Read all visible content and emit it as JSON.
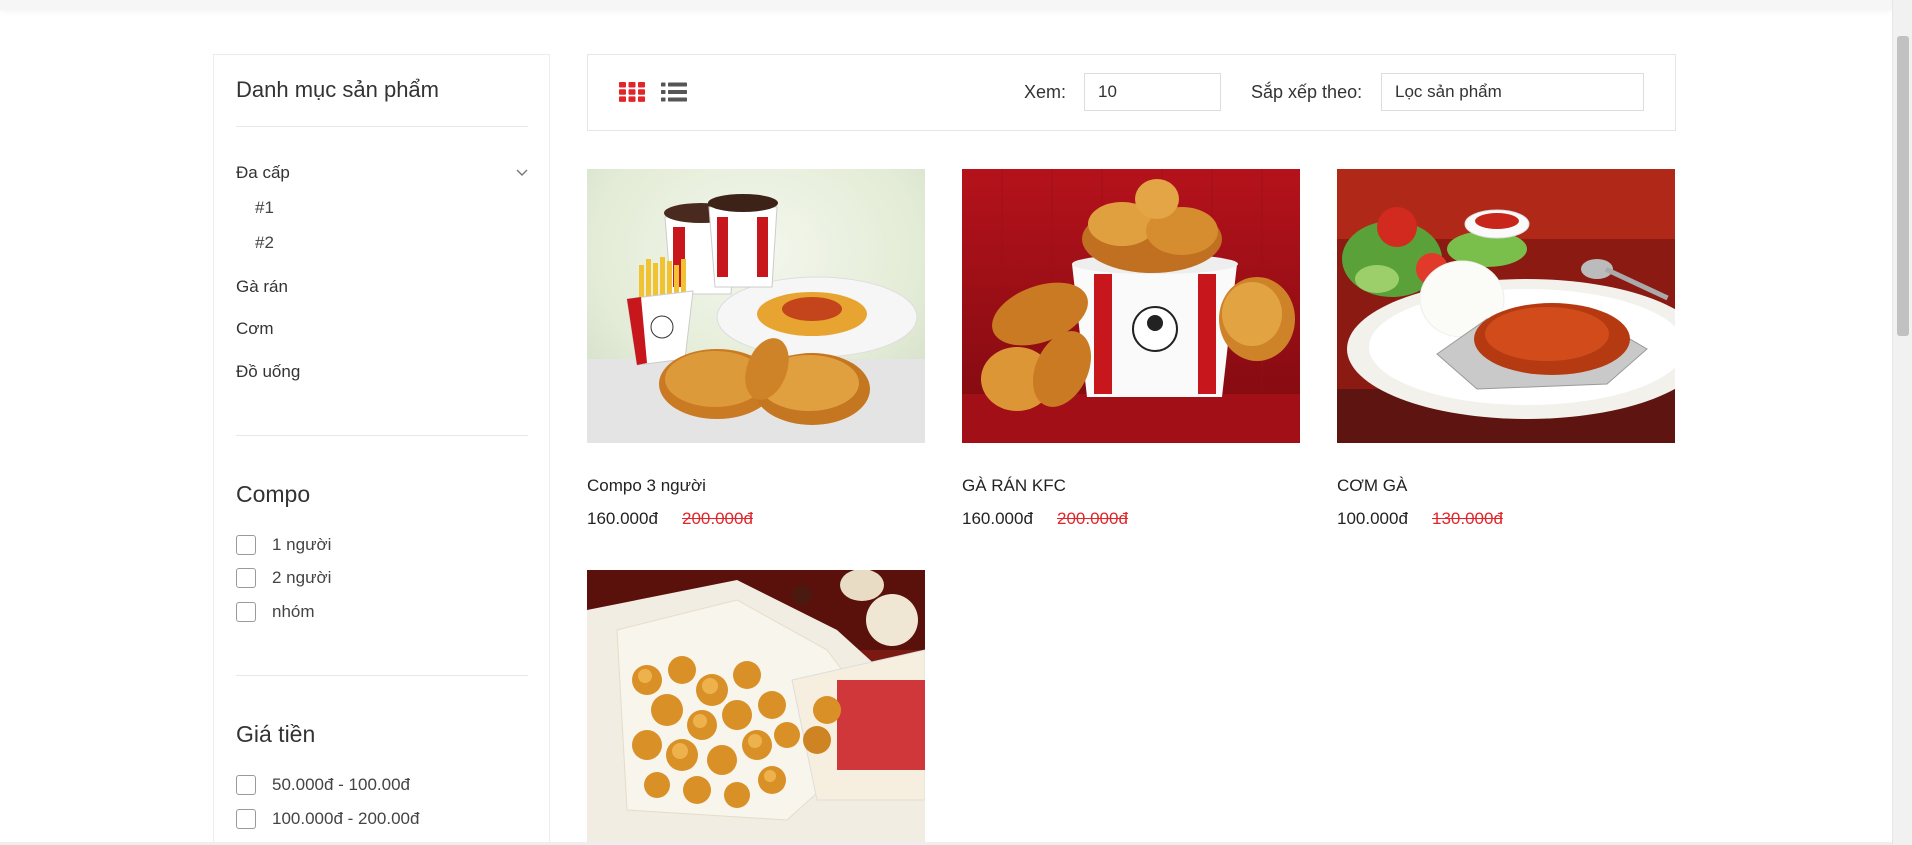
{
  "sidebar": {
    "title": "Danh mục sản phẩm",
    "categories": [
      {
        "label": "Đa cấp",
        "children": [
          "#1",
          "#2"
        ]
      },
      {
        "label": "Gà rán"
      },
      {
        "label": "Cơm"
      },
      {
        "label": "Đồ uống"
      }
    ],
    "compo": {
      "heading": "Compo",
      "options": [
        "1 người",
        "2 người",
        "nhóm"
      ]
    },
    "price": {
      "heading": "Giá tiền",
      "options": [
        "50.000đ - 100.00đ",
        "100.000đ - 200.00đ"
      ]
    }
  },
  "toolbar": {
    "view_label": "Xem:",
    "view_value": "10",
    "sort_label": "Sắp xếp theo:",
    "sort_value": "Lọc sản phẩm",
    "grid_icon": "grid-view-icon",
    "list_icon": "list-view-icon",
    "accent_color": "#e0262b"
  },
  "products": [
    {
      "name": "Compo 3 người",
      "price": "160.000đ",
      "old_price": "200.000đ"
    },
    {
      "name": "GÀ RÁN KFC",
      "price": "160.000đ",
      "old_price": "200.000đ"
    },
    {
      "name": "CƠM GÀ",
      "price": "100.000đ",
      "old_price": "130.000đ"
    },
    {
      "name": "",
      "price": "",
      "old_price": ""
    }
  ],
  "colors": {
    "accent": "#e0262b",
    "kfc_red": "#c8161d"
  }
}
